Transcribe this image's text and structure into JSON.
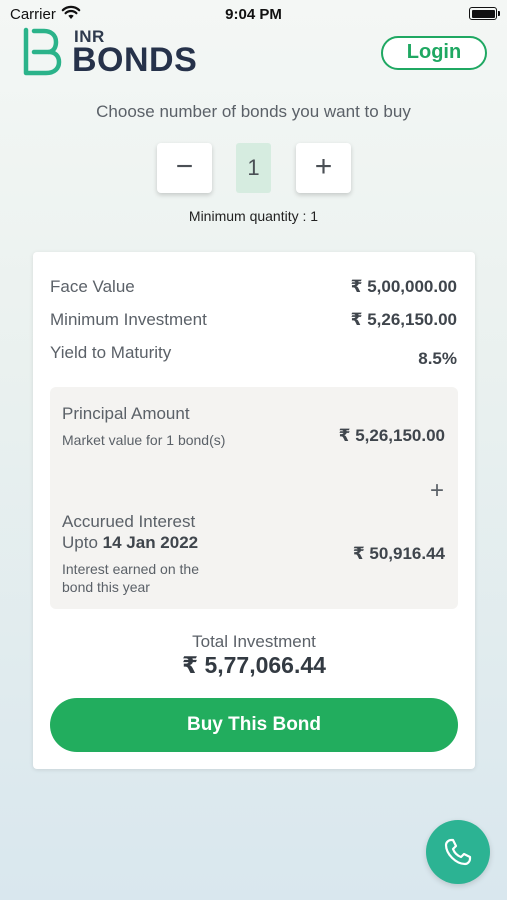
{
  "status_bar": {
    "carrier": "Carrier",
    "time": "9:04 PM"
  },
  "header": {
    "brand_small": "INR",
    "brand_big": "BONDS",
    "login_label": "Login"
  },
  "quantity": {
    "prompt": "Choose number of bonds you want to buy",
    "minus": "−",
    "plus": "+",
    "value": "1",
    "min_note": "Minimum quantity : 1"
  },
  "details": {
    "face_value_label": "Face Value",
    "face_value": "₹ 5,00,000.00",
    "min_investment_label": "Minimum Investment",
    "min_investment": "₹ 5,26,150.00",
    "ytm_label": "Yield to Maturity",
    "ytm": "8.5%"
  },
  "breakdown": {
    "principal_label": "Principal Amount",
    "principal_sub": "Market value for 1 bond(s)",
    "principal_value": "₹ 5,26,150.00",
    "plus": "+",
    "interest_label": "Accurued Interest",
    "upto_label": "Upto",
    "upto_date": "14 Jan 2022",
    "interest_sub": "Interest earned on the bond this year",
    "interest_value": "₹ 50,916.44"
  },
  "total": {
    "label": "Total Investment",
    "value": "₹ 5,77,066.44"
  },
  "cta": {
    "buy_label": "Buy This Bond"
  },
  "colors": {
    "brand_green": "#1fa862",
    "button_green": "#22ad5e",
    "fab_teal": "#2cb393",
    "navy": "#26324a"
  },
  "icons": {
    "wifi": "wifi-icon",
    "battery": "battery-icon",
    "logo": "bonds-logo-icon",
    "call": "phone-icon"
  }
}
